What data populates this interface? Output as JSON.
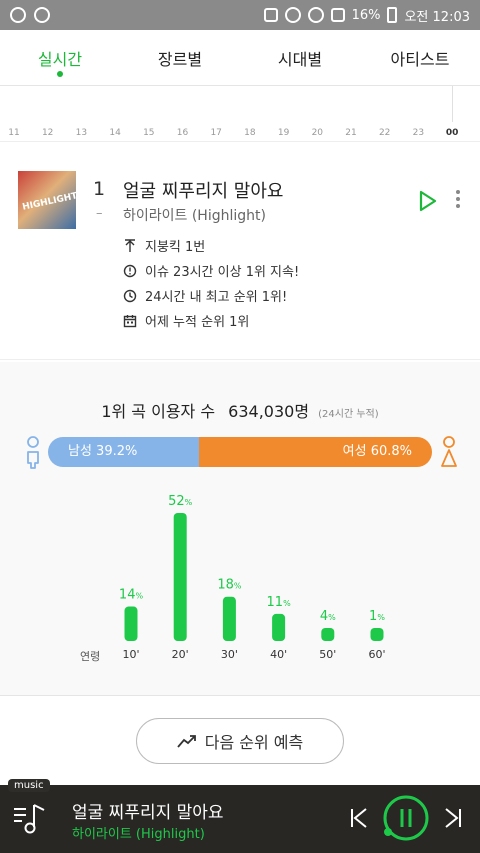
{
  "statusbar": {
    "battery": "16%",
    "time": "오전 12:03"
  },
  "tabs": [
    {
      "label": "실시간",
      "active": true
    },
    {
      "label": "장르별",
      "active": false
    },
    {
      "label": "시대별",
      "active": false
    },
    {
      "label": "아티스트",
      "active": false
    }
  ],
  "timeline": {
    "hours": [
      "11",
      "12",
      "13",
      "14",
      "15",
      "16",
      "17",
      "18",
      "19",
      "20",
      "21",
      "22",
      "23",
      "00"
    ],
    "current_hour": "00"
  },
  "song": {
    "rank": "1",
    "change": "–",
    "title": "얼굴 찌푸리지 말아요",
    "artist": "하이라이트 (Highlight)",
    "cover_text": "HIGHLIGHT",
    "features": [
      {
        "icon": "trend-up-icon",
        "text": "지붕킥 1번"
      },
      {
        "icon": "timer-icon",
        "text": "이슈 23시간 이상 1위 지속!"
      },
      {
        "icon": "clock-icon",
        "text": "24시간 내 최고 순위 1위!"
      },
      {
        "icon": "calendar-icon",
        "text": "어제 누적 순위 1위"
      }
    ]
  },
  "stats": {
    "users_label": "1위 곡 이용자 수",
    "users_count": "634,030명",
    "users_note": "(24시간 누적)",
    "male_label": "남성 39.2%",
    "female_label": "여성 60.8%",
    "male_share": 39.2,
    "age_axis_label": "연령"
  },
  "chart_data": {
    "type": "bar",
    "categories": [
      "10'",
      "20'",
      "30'",
      "40'",
      "50'",
      "60'"
    ],
    "values": [
      14,
      52,
      18,
      11,
      4,
      1
    ],
    "value_unit": "%",
    "xlabel": "연령",
    "color": "#1ec94a"
  },
  "predict_button": "다음 순위 예측",
  "player": {
    "badge": "music",
    "title": "얼굴 찌푸리지 말아요",
    "artist": "하이라이트 (Highlight)",
    "accent": "#1ec94a"
  }
}
